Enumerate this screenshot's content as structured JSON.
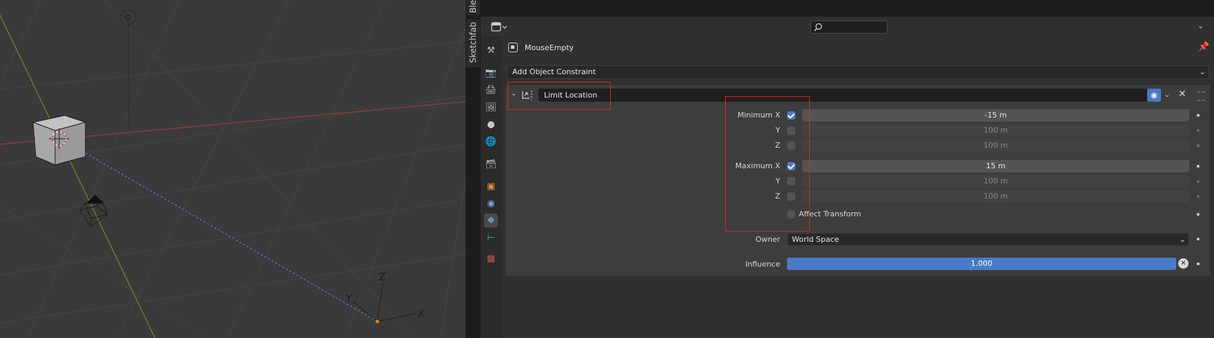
{
  "sidebar_tabs": [
    "Ble",
    "Sketchfab"
  ],
  "viewport": {
    "axis_gizmo": [
      "Z",
      "Y",
      "X"
    ]
  },
  "header": {
    "search_placeholder": ""
  },
  "object": {
    "name": "MouseEmpty"
  },
  "add_constraint_label": "Add Object Constraint",
  "constraint": {
    "name": "Limit Location",
    "rows": [
      {
        "label": "Minimum X",
        "checked": true,
        "value": "-15 m"
      },
      {
        "label": "Y",
        "checked": false,
        "value": "100 m"
      },
      {
        "label": "Z",
        "checked": false,
        "value": "100 m"
      },
      {
        "label": "Maximum X",
        "checked": true,
        "value": "15 m"
      },
      {
        "label": "Y",
        "checked": false,
        "value": "100 m"
      },
      {
        "label": "Z",
        "checked": false,
        "value": "100 m"
      }
    ],
    "affect_transform": {
      "label": "Affect Transform",
      "checked": false
    },
    "owner": {
      "label": "Owner",
      "value": "World Space"
    },
    "influence": {
      "label": "Influence",
      "value": "1.000",
      "fraction": 1.0
    }
  },
  "colors": {
    "accent": "#4a7ac7",
    "highlight": "#e0231f"
  }
}
